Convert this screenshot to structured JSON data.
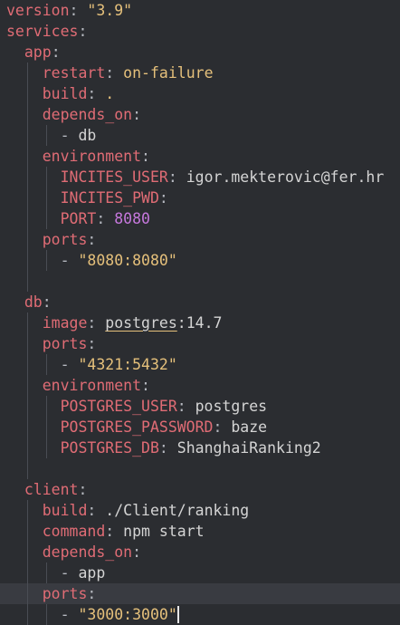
{
  "editor": {
    "current_line": 28,
    "lines": [
      {
        "depth": 0,
        "tokens": [
          [
            "key",
            "version"
          ],
          [
            "punct",
            ": "
          ],
          [
            "str",
            "\"3.9\""
          ]
        ]
      },
      {
        "depth": 0,
        "tokens": [
          [
            "key",
            "services"
          ],
          [
            "punct",
            ":"
          ]
        ]
      },
      {
        "depth": 1,
        "tokens": [
          [
            "key",
            "app"
          ],
          [
            "punct",
            ":"
          ]
        ]
      },
      {
        "depth": 2,
        "tokens": [
          [
            "key",
            "restart"
          ],
          [
            "punct",
            ": "
          ],
          [
            "str",
            "on-failure"
          ]
        ]
      },
      {
        "depth": 2,
        "tokens": [
          [
            "key",
            "build"
          ],
          [
            "punct",
            ": "
          ],
          [
            "str",
            "."
          ]
        ]
      },
      {
        "depth": 2,
        "tokens": [
          [
            "key",
            "depends_on"
          ],
          [
            "punct",
            ":"
          ]
        ]
      },
      {
        "depth": 3,
        "tokens": [
          [
            "punct",
            "- "
          ],
          [
            "plain",
            "db"
          ]
        ]
      },
      {
        "depth": 2,
        "tokens": [
          [
            "key",
            "environment"
          ],
          [
            "punct",
            ":"
          ]
        ]
      },
      {
        "depth": 3,
        "tokens": [
          [
            "key",
            "INCITES_USER"
          ],
          [
            "punct",
            ": "
          ],
          [
            "plain",
            "igor.mekterovic@fer.hr"
          ]
        ]
      },
      {
        "depth": 3,
        "tokens": [
          [
            "key",
            "INCITES_PWD"
          ],
          [
            "punct",
            ":"
          ]
        ]
      },
      {
        "depth": 3,
        "tokens": [
          [
            "key",
            "PORT"
          ],
          [
            "punct",
            ": "
          ],
          [
            "num",
            "8080"
          ]
        ]
      },
      {
        "depth": 2,
        "tokens": [
          [
            "key",
            "ports"
          ],
          [
            "punct",
            ":"
          ]
        ]
      },
      {
        "depth": 3,
        "tokens": [
          [
            "punct",
            "- "
          ],
          [
            "str",
            "\"8080:8080\""
          ]
        ]
      },
      {
        "depth": 0,
        "tokens": [],
        "guides": 1
      },
      {
        "depth": 1,
        "tokens": [
          [
            "key",
            "db"
          ],
          [
            "punct",
            ":"
          ]
        ]
      },
      {
        "depth": 2,
        "tokens": [
          [
            "key",
            "image"
          ],
          [
            "punct",
            ": "
          ],
          [
            "plain uline",
            "postgres"
          ],
          [
            "plain",
            ":14.7"
          ]
        ]
      },
      {
        "depth": 2,
        "tokens": [
          [
            "key",
            "ports"
          ],
          [
            "punct",
            ":"
          ]
        ]
      },
      {
        "depth": 3,
        "tokens": [
          [
            "punct",
            "- "
          ],
          [
            "str",
            "\"4321:5432\""
          ]
        ]
      },
      {
        "depth": 2,
        "tokens": [
          [
            "key",
            "environment"
          ],
          [
            "punct",
            ":"
          ]
        ]
      },
      {
        "depth": 3,
        "tokens": [
          [
            "key",
            "POSTGRES_USER"
          ],
          [
            "punct",
            ": "
          ],
          [
            "plain",
            "postgres"
          ]
        ]
      },
      {
        "depth": 3,
        "tokens": [
          [
            "key",
            "POSTGRES_PASSWORD"
          ],
          [
            "punct",
            ": "
          ],
          [
            "plain",
            "baze"
          ]
        ]
      },
      {
        "depth": 3,
        "tokens": [
          [
            "key",
            "POSTGRES_DB"
          ],
          [
            "punct",
            ": "
          ],
          [
            "plain",
            "ShanghaiRanking2"
          ]
        ]
      },
      {
        "depth": 0,
        "tokens": [],
        "guides": 1
      },
      {
        "depth": 1,
        "tokens": [
          [
            "key",
            "client"
          ],
          [
            "punct",
            ":"
          ]
        ]
      },
      {
        "depth": 2,
        "tokens": [
          [
            "key",
            "build"
          ],
          [
            "punct",
            ": "
          ],
          [
            "plain",
            "./Client/ranking"
          ]
        ]
      },
      {
        "depth": 2,
        "tokens": [
          [
            "key",
            "command"
          ],
          [
            "punct",
            ": "
          ],
          [
            "plain",
            "npm start"
          ]
        ]
      },
      {
        "depth": 2,
        "tokens": [
          [
            "key",
            "depends_on"
          ],
          [
            "punct",
            ":"
          ]
        ]
      },
      {
        "depth": 3,
        "tokens": [
          [
            "punct",
            "- "
          ],
          [
            "plain",
            "app"
          ]
        ]
      },
      {
        "depth": 2,
        "tokens": [
          [
            "key",
            "ports"
          ],
          [
            "punct",
            ":"
          ]
        ]
      },
      {
        "depth": 3,
        "tokens": [
          [
            "punct",
            "- "
          ],
          [
            "str",
            "\"3000:3000\""
          ]
        ],
        "caret": true
      }
    ]
  }
}
